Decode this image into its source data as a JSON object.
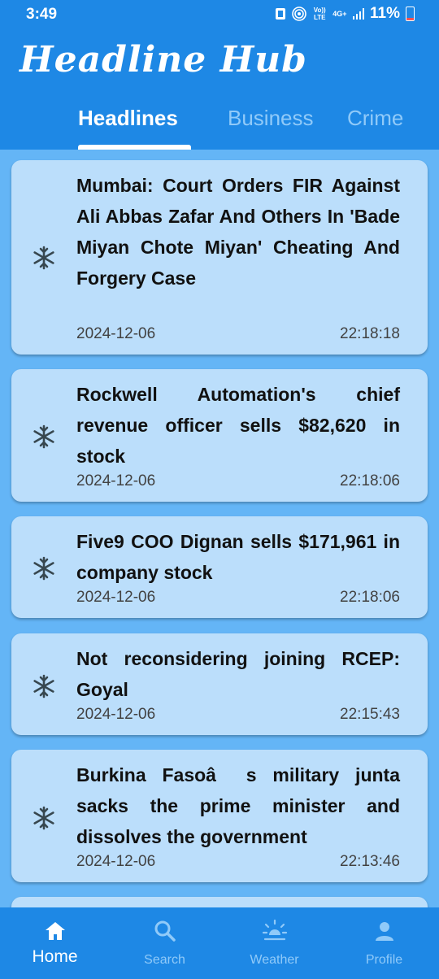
{
  "status_bar": {
    "time": "3:49",
    "network_1": "Vo)) LTE",
    "network_2": "4G+",
    "battery": "11%"
  },
  "app": {
    "title": "Headline Hub"
  },
  "tabs": [
    {
      "label": "Headlines",
      "active": true
    },
    {
      "label": "Business",
      "active": false
    },
    {
      "label": "Crime",
      "active": false
    }
  ],
  "articles": [
    {
      "title": "Mumbai: Court Orders FIR Against Ali Abbas Zafar And Others In 'Bade Miyan Chote Miyan' Cheating And Forgery Case",
      "date": "2024-12-06",
      "time": "22:18:18",
      "icon": "snowflake-icon"
    },
    {
      "title": "Rockwell Automation's chief revenue officer sells $82,620 in stock",
      "date": "2024-12-06",
      "time": "22:18:06",
      "icon": "snowflake-icon"
    },
    {
      "title": "Five9 COO Dignan sells $171,961 in company stock",
      "date": "2024-12-06",
      "time": "22:18:06",
      "icon": "snowflake-icon"
    },
    {
      "title": "Not reconsidering joining RCEP: Goyal",
      "date": "2024-12-06",
      "time": "22:15:43",
      "icon": "snowflake-icon"
    },
    {
      "title": "Burkina Fasoâs military junta sacks the prime minister and dissolves the government",
      "date": "2024-12-06",
      "time": "22:13:46",
      "icon": "snowflake-icon"
    }
  ],
  "bottom_nav": [
    {
      "label": "Home",
      "icon": "home-icon",
      "active": true
    },
    {
      "label": "Search",
      "icon": "search-icon",
      "active": false
    },
    {
      "label": "Weather",
      "icon": "weather-sun-icon",
      "active": false
    },
    {
      "label": "Profile",
      "icon": "profile-icon",
      "active": false
    }
  ],
  "colors": {
    "primary": "#1e88e5",
    "background": "#64b5f6",
    "card": "#bbdefb",
    "tab_inactive": "#90caf9"
  }
}
